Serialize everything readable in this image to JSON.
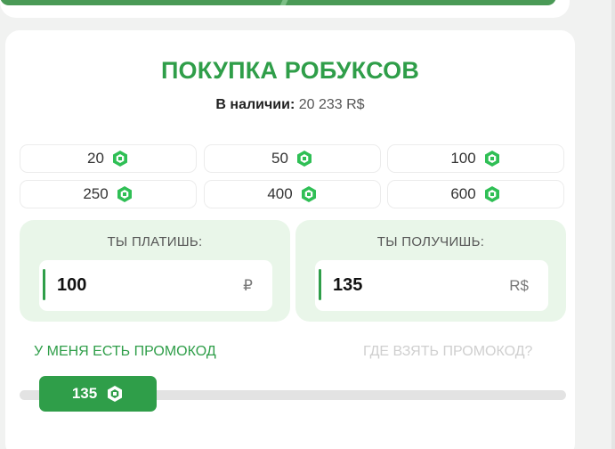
{
  "header": {
    "title": "ПОКУПКА РОБУКСОВ",
    "stock_label": "В наличии:",
    "stock_value": "20 233 R$"
  },
  "presets": [
    {
      "amount": "20",
      "icon": "robux-icon"
    },
    {
      "amount": "50",
      "icon": "robux-icon"
    },
    {
      "amount": "100",
      "icon": "robux-icon"
    },
    {
      "amount": "250",
      "icon": "robux-icon"
    },
    {
      "amount": "400",
      "icon": "robux-icon"
    },
    {
      "amount": "600",
      "icon": "robux-icon"
    }
  ],
  "pay": {
    "label": "ТЫ ПЛАТИШЬ:",
    "value": "100",
    "currency": "₽"
  },
  "receive": {
    "label": "ТЫ ПОЛУЧИШЬ:",
    "value": "135",
    "currency": "R$"
  },
  "promo": {
    "have_code": "У МЕНЯ ЕСТЬ ПРОМОКОД",
    "where_code": "ГДЕ ВЗЯТЬ ПРОМОКОД?"
  },
  "slider": {
    "value": "135",
    "icon": "robux-icon",
    "position_fraction": 0.0
  },
  "colors": {
    "accent": "#2f9e49",
    "panel_bg": "#e9f6e9",
    "muted": "#cfcfcf"
  }
}
